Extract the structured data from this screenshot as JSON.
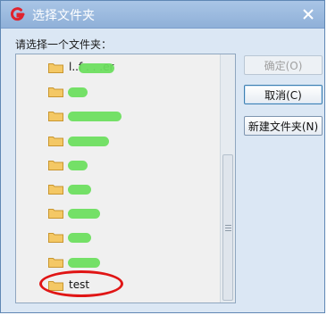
{
  "window": {
    "title": "选择文件夹"
  },
  "prompt": "请选择一个文件夹：",
  "buttons": {
    "ok": "确定(O)",
    "cancel": "取消(C)",
    "new_folder": "新建文件夹(N)"
  },
  "folders": [
    {
      "label": "l..f  . . .er",
      "redacted": true
    },
    {
      "label": "",
      "redacted": true
    },
    {
      "label": "",
      "redacted": true
    },
    {
      "label": "",
      "redacted": true
    },
    {
      "label": "",
      "redacted": true
    },
    {
      "label": "",
      "redacted": true
    },
    {
      "label": "",
      "redacted": true
    },
    {
      "label": "",
      "redacted": true
    },
    {
      "label": "",
      "redacted": true
    },
    {
      "label": "test",
      "redacted": false
    }
  ],
  "colors": {
    "accent": "#e01515",
    "title_bar": "#8fb0d8",
    "redaction": "#6dde5f"
  },
  "icons": {
    "app": "app-logo-icon",
    "close": "close-icon",
    "folder": "folder-icon"
  }
}
